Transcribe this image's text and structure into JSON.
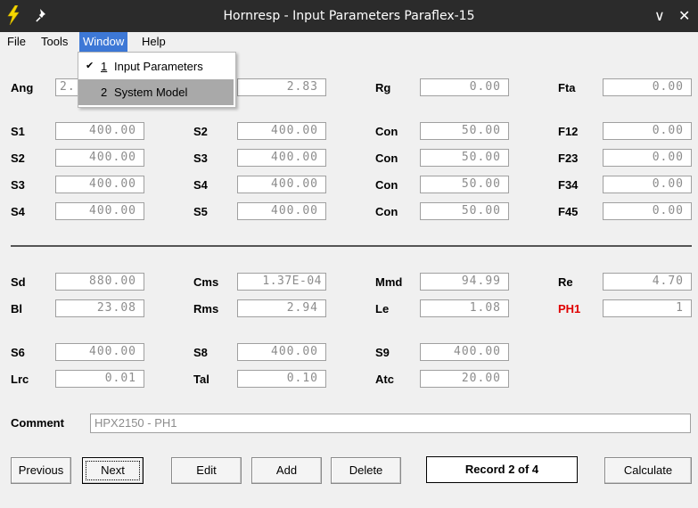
{
  "window": {
    "title": "Hornresp - Input Parameters Paraflex-15",
    "minimize_glyph": "∨",
    "close_glyph": "✕"
  },
  "menu": {
    "file": "File",
    "tools": "Tools",
    "window": "Window",
    "help": "Help"
  },
  "dropdown": {
    "item1_check": "✔",
    "item1_num": "1",
    "item1_label": "Input Parameters",
    "item2_num": "2",
    "item2_label": "System Model"
  },
  "row_ang": {
    "ang_label": "Ang",
    "ang_value": "2.",
    "col2_value": "2.83",
    "rg_label": "Rg",
    "rg_value": "0.00",
    "fta_label": "Fta",
    "fta_value": "0.00"
  },
  "segments": [
    {
      "a_label": "S1",
      "a_value": "400.00",
      "b_label": "S2",
      "b_value": "400.00",
      "c_label": "Con",
      "c_value": "50.00",
      "d_label": "F12",
      "d_value": "0.00"
    },
    {
      "a_label": "S2",
      "a_value": "400.00",
      "b_label": "S3",
      "b_value": "400.00",
      "c_label": "Con",
      "c_value": "50.00",
      "d_label": "F23",
      "d_value": "0.00"
    },
    {
      "a_label": "S3",
      "a_value": "400.00",
      "b_label": "S4",
      "b_value": "400.00",
      "c_label": "Con",
      "c_value": "50.00",
      "d_label": "F34",
      "d_value": "0.00"
    },
    {
      "a_label": "S4",
      "a_value": "400.00",
      "b_label": "S5",
      "b_value": "400.00",
      "c_label": "Con",
      "c_value": "50.00",
      "d_label": "F45",
      "d_value": "0.00"
    }
  ],
  "driver": {
    "sd_label": "Sd",
    "sd_value": "880.00",
    "cms_label": "Cms",
    "cms_value": "1.37E-04",
    "mmd_label": "Mmd",
    "mmd_value": "94.99",
    "re_label": "Re",
    "re_value": "4.70",
    "bl_label": "Bl",
    "bl_value": "23.08",
    "rms_label": "Rms",
    "rms_value": "2.94",
    "le_label": "Le",
    "le_value": "1.08",
    "ph1_label": "PH1",
    "ph1_value": "1",
    "ph1_color": "#e00000"
  },
  "chambers": {
    "s6_label": "S6",
    "s6_value": "400.00",
    "s8_label": "S8",
    "s8_value": "400.00",
    "s9_label": "S9",
    "s9_value": "400.00",
    "lrc_label": "Lrc",
    "lrc_value": "0.01",
    "tal_label": "Tal",
    "tal_value": "0.10",
    "atc_label": "Atc",
    "atc_value": "20.00"
  },
  "comment": {
    "label": "Comment",
    "value": "HPX2150 - PH1"
  },
  "buttons": {
    "previous": "Previous",
    "next": "Next",
    "edit": "Edit",
    "add": "Add",
    "delete": "Delete",
    "record": "Record 2 of 4",
    "calculate": "Calculate"
  },
  "colors": {
    "titlebar": "#2b2b2b",
    "menu_active": "#3d78d6",
    "field_text": "#8c8c8c",
    "dropdown_highlight": "#a9a9a9"
  },
  "icons": [
    "lightning-icon",
    "pin-icon",
    "chevron-down-icon",
    "close-icon",
    "checkmark-icon"
  ]
}
